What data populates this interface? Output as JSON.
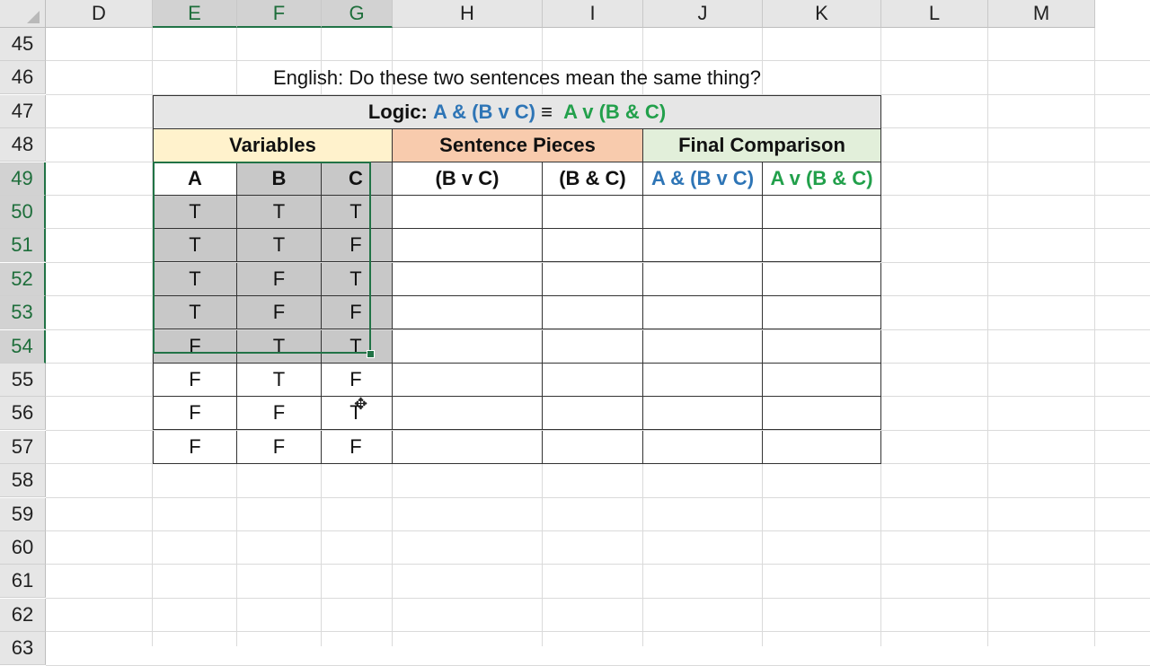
{
  "columns": [
    "D",
    "E",
    "F",
    "G",
    "H",
    "I",
    "J",
    "K",
    "L",
    "M"
  ],
  "rows": [
    "45",
    "46",
    "47",
    "48",
    "49",
    "50",
    "51",
    "52",
    "53",
    "54",
    "55",
    "56",
    "57",
    "58",
    "59",
    "60",
    "61",
    "62",
    "63"
  ],
  "question": "English: Do these two sentences mean the same thing?",
  "logic": {
    "prefix": "Logic: ",
    "left": "A & (B v C)",
    "equiv": " ≡ ",
    "right": "A v (B & C)"
  },
  "groups": {
    "variables": "Variables",
    "pieces": "Sentence Pieces",
    "final": "Final Comparison"
  },
  "headers": {
    "a": "A",
    "b": "B",
    "c": "C",
    "bvc": "(B v C)",
    "bac": "(B & C)",
    "left": "A & (B v C)",
    "right": "A v (B & C)"
  },
  "truth_table": [
    [
      "T",
      "T",
      "T"
    ],
    [
      "T",
      "T",
      "F"
    ],
    [
      "T",
      "F",
      "T"
    ],
    [
      "T",
      "F",
      "F"
    ],
    [
      "F",
      "T",
      "T"
    ],
    [
      "F",
      "T",
      "F"
    ],
    [
      "F",
      "F",
      "T"
    ],
    [
      "F",
      "F",
      "F"
    ]
  ],
  "colors": {
    "logic_bg": "#e6e6e6",
    "variables_bg": "#fff2cc",
    "pieces_bg": "#f8cbad",
    "final_bg": "#e2efda",
    "selected_fill": "#c8c8c8",
    "blue": "#2e75b6",
    "green": "#22a04b"
  }
}
